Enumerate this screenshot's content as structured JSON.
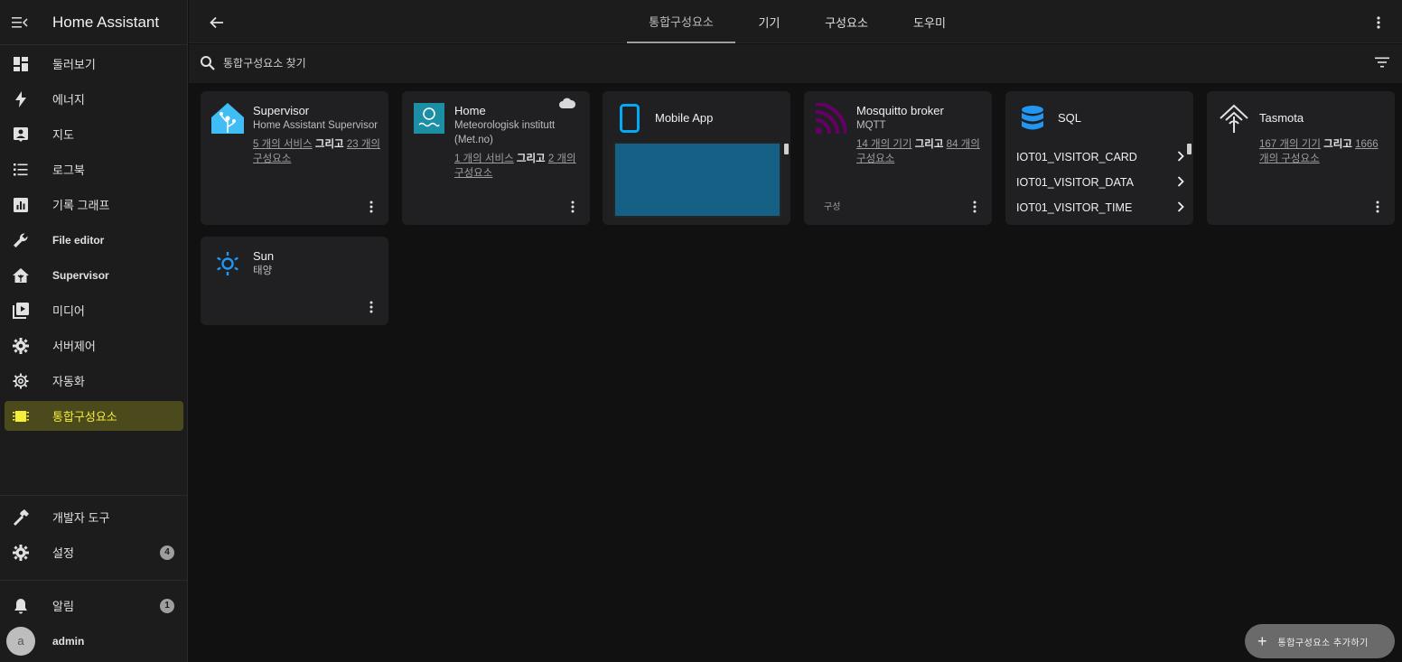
{
  "app": {
    "title": "Home Assistant"
  },
  "sidebar": {
    "items": [
      {
        "label": "둘러보기",
        "icon": "dashboard-icon"
      },
      {
        "label": "에너지",
        "icon": "lightning-icon"
      },
      {
        "label": "지도",
        "icon": "account-box-icon"
      },
      {
        "label": "로그북",
        "icon": "list-icon"
      },
      {
        "label": "기록 그래프",
        "icon": "chart-box-icon"
      },
      {
        "label": "File editor",
        "icon": "wrench-icon"
      },
      {
        "label": "Supervisor",
        "icon": "home-assistant-icon"
      },
      {
        "label": "미디어",
        "icon": "play-box-icon"
      },
      {
        "label": "서버제어",
        "icon": "cog-icon"
      },
      {
        "label": "자동화",
        "icon": "cog-outline-icon"
      },
      {
        "label": "통합구성요소",
        "icon": "chip-icon"
      }
    ],
    "developer_tools": "개발자 도구",
    "settings": "설정",
    "settings_badge": "4",
    "notifications": "알림",
    "notifications_badge": "1",
    "user_initial": "a",
    "user_name": "admin",
    "active_color": "#f5ef3a"
  },
  "tabs": [
    {
      "label": "통합구성요소",
      "active": true
    },
    {
      "label": "기기"
    },
    {
      "label": "구성요소"
    },
    {
      "label": "도우미"
    }
  ],
  "search": {
    "placeholder": "통합구성요소 찾기"
  },
  "cards": {
    "supervisor": {
      "name": "Supervisor",
      "subtitle": "Home Assistant Supervisor",
      "link1": "5 개의 서비스",
      "and": "그리고",
      "link2": "23 개의 구성요소"
    },
    "home": {
      "name": "Home",
      "subtitle": "Meteorologisk institutt (Met.no)",
      "link1": "1 개의 서비스",
      "and": "그리고",
      "link2": "2 개의 구성요소"
    },
    "mobile_app": {
      "name": "Mobile App"
    },
    "mosquitto": {
      "name": "Mosquitto broker",
      "subtitle": "MQTT",
      "link1": "14 개의 기기",
      "and": "그리고",
      "link2": "84 개의 구성요소",
      "configure": "구성"
    },
    "sql": {
      "name": "SQL",
      "entries": [
        "IOT01_VISITOR_CARD",
        "IOT01_VISITOR_DATA",
        "IOT01_VISITOR_TIME"
      ]
    },
    "tasmota": {
      "name": "Tasmota",
      "link1": "167 개의 기기",
      "and": "그리고",
      "link2": "1666 개의 구성요소"
    },
    "sun": {
      "name": "Sun",
      "subtitle": "태양"
    }
  },
  "fab": {
    "label": "통합구성요소 추가하기"
  },
  "colors": {
    "supervisor_blue": "#41bdf5",
    "met_teal": "#1d8fa5",
    "mobile_blue": "#03a9f4",
    "mqtt_purple": "#660066",
    "sql_blue": "#2196f3",
    "mobile_fill": "#156185"
  }
}
